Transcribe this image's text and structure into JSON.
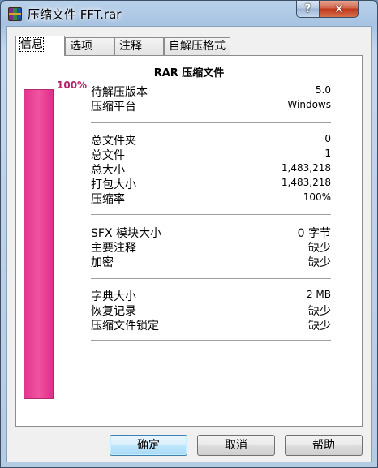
{
  "window": {
    "title": "压缩文件 FFT.rar",
    "help_glyph": "?",
    "close_glyph": "✕"
  },
  "tabs": [
    {
      "label": "信息",
      "active": true
    },
    {
      "label": "选项",
      "active": false
    },
    {
      "label": "注释",
      "active": false
    },
    {
      "label": "自解压格式",
      "active": false
    }
  ],
  "panel": {
    "title": "RAR 压缩文件",
    "progress": {
      "percent": 100,
      "label": "100%",
      "color": "#e6398f"
    },
    "groups": [
      [
        {
          "key": "待解压版本",
          "value": "5.0"
        },
        {
          "key": "压缩平台",
          "value": "Windows"
        }
      ],
      [
        {
          "key": "总文件夹",
          "value": "0"
        },
        {
          "key": "总文件",
          "value": "1"
        },
        {
          "key": "总大小",
          "value": "1,483,218"
        },
        {
          "key": "打包大小",
          "value": "1,483,218"
        },
        {
          "key": "压缩率",
          "value": "100%"
        }
      ],
      [
        {
          "key": "SFX 模块大小",
          "value": "0 字节"
        },
        {
          "key": "主要注释",
          "value": "缺少"
        },
        {
          "key": "加密",
          "value": "缺少"
        }
      ],
      [
        {
          "key": "字典大小",
          "value": "2 MB"
        },
        {
          "key": "恢复记录",
          "value": "缺少"
        },
        {
          "key": "压缩文件锁定",
          "value": "缺少"
        }
      ]
    ]
  },
  "buttons": {
    "ok": "确定",
    "cancel": "取消",
    "help": "帮助"
  }
}
